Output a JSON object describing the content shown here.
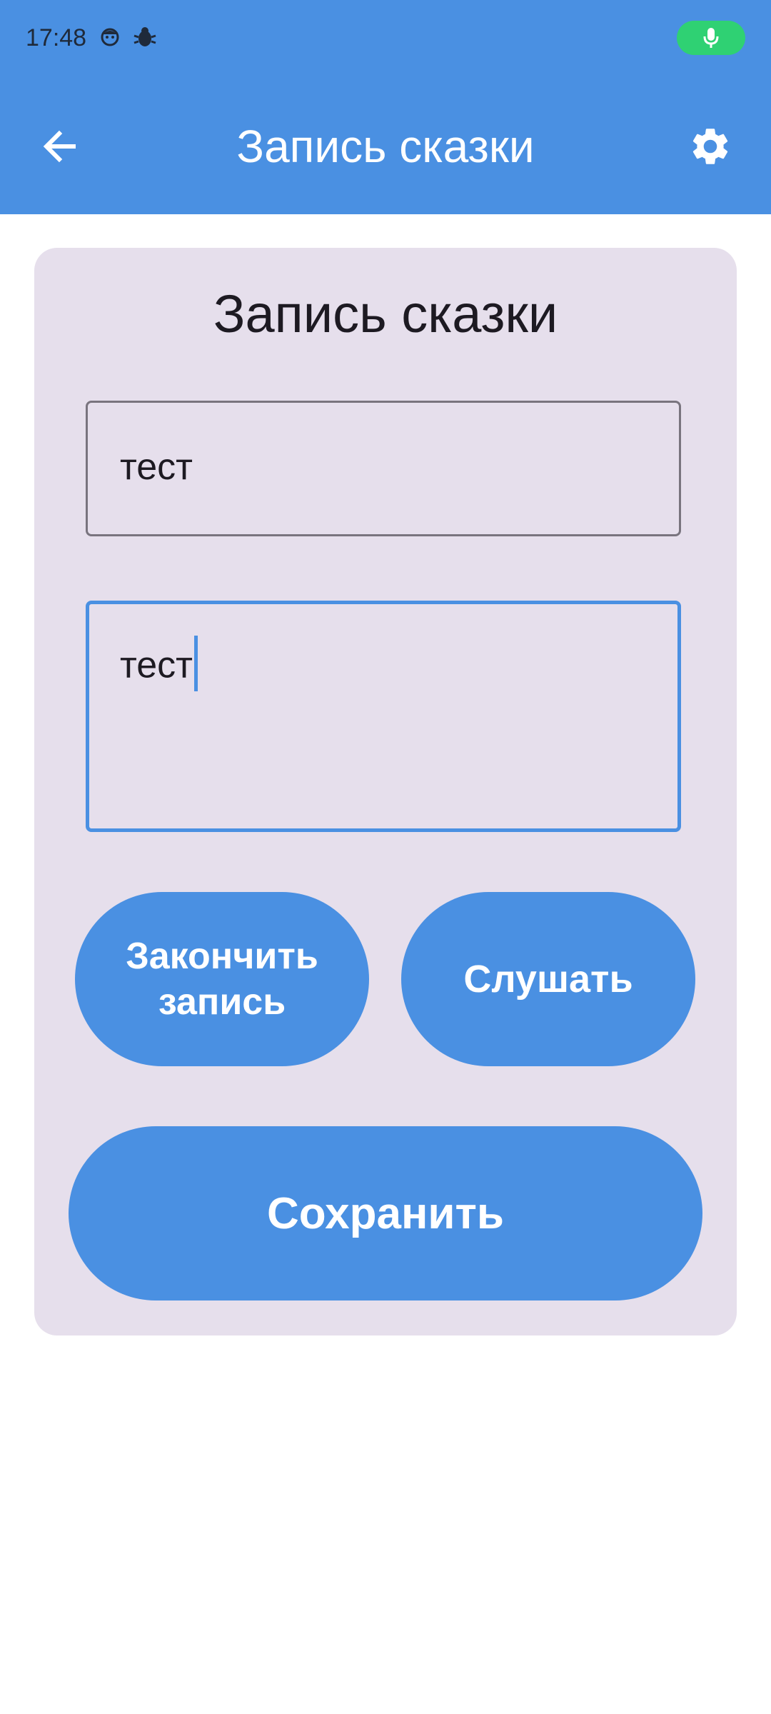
{
  "status_bar": {
    "time": "17:48",
    "icons": [
      "face-icon",
      "bug-icon",
      "mic-icon"
    ],
    "mic_color": "#2fd173"
  },
  "app_bar": {
    "title": "Запись сказки",
    "back_icon": "arrow-left-icon",
    "settings_icon": "gear-icon",
    "color": "#4a90e2"
  },
  "card": {
    "title": "Запись сказки",
    "title_field": {
      "value": "тест"
    },
    "story_field": {
      "value": "тест"
    },
    "buttons": {
      "stop_recording": "Закончить запись",
      "listen": "Слушать",
      "save": "Сохранить"
    },
    "background": "#e6dfec"
  }
}
